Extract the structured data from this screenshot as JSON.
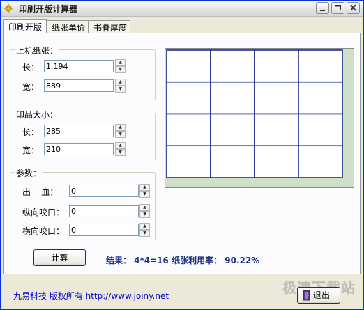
{
  "window": {
    "title": "印刷开版计算器"
  },
  "tabs": [
    {
      "label": "印刷开版"
    },
    {
      "label": "纸张单价"
    },
    {
      "label": "书脊厚度"
    }
  ],
  "sections": {
    "machine_paper": {
      "title": "上机纸张：",
      "length_label": "长：",
      "length_value": "1,194",
      "width_label": "宽：",
      "width_value": "889"
    },
    "print_size": {
      "title": "印品大小：",
      "length_label": "长：",
      "length_value": "285",
      "width_label": "宽：",
      "width_value": "210"
    },
    "params": {
      "title": "参数：",
      "bleed_label": "出    血：",
      "bleed_value": "0",
      "vertical_bite_label": "纵向咬口：",
      "vertical_bite_value": "0",
      "horizontal_bite_label": "横向咬口：",
      "horizontal_bite_value": "0"
    }
  },
  "preview": {
    "rows": 4,
    "cols": 4,
    "grid_color": "#1b2a8f",
    "waste_color": "#cfe0c8"
  },
  "actions": {
    "calculate_label": "计算",
    "exit_label": "退出"
  },
  "result_text": "结果： 4*4=16  纸张利用率： 90.22%",
  "footer": {
    "link_text": "九易科技 版权所有  http://www.joiny.net"
  },
  "watermark_text": "极速下载站",
  "colors": {
    "title_bar": "#e3e3e3",
    "tab_accent": "#e68b2c",
    "result": "#1c2f8a",
    "link": "#0000cc"
  }
}
